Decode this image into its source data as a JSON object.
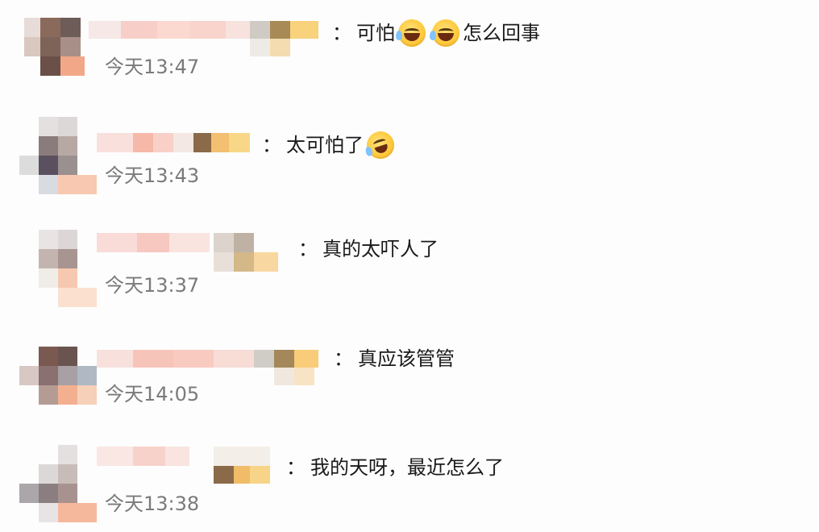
{
  "comments": [
    {
      "text": "可怕",
      "text_after": "怎么回事",
      "time": "今天13:47",
      "emoji_before": "laughing-tears-emoji",
      "emoji_after": "laughing-tears-emoji"
    },
    {
      "text": "太可怕了",
      "time": "今天13:43",
      "emoji_after": "rolling-laugh-emoji"
    },
    {
      "text": "真的太吓人了",
      "time": "今天13:37"
    },
    {
      "text": "真应该管管",
      "time": "今天14:05"
    },
    {
      "text": "我的天呀，最近怎么了",
      "time": "今天13:38"
    }
  ],
  "colon": "："
}
